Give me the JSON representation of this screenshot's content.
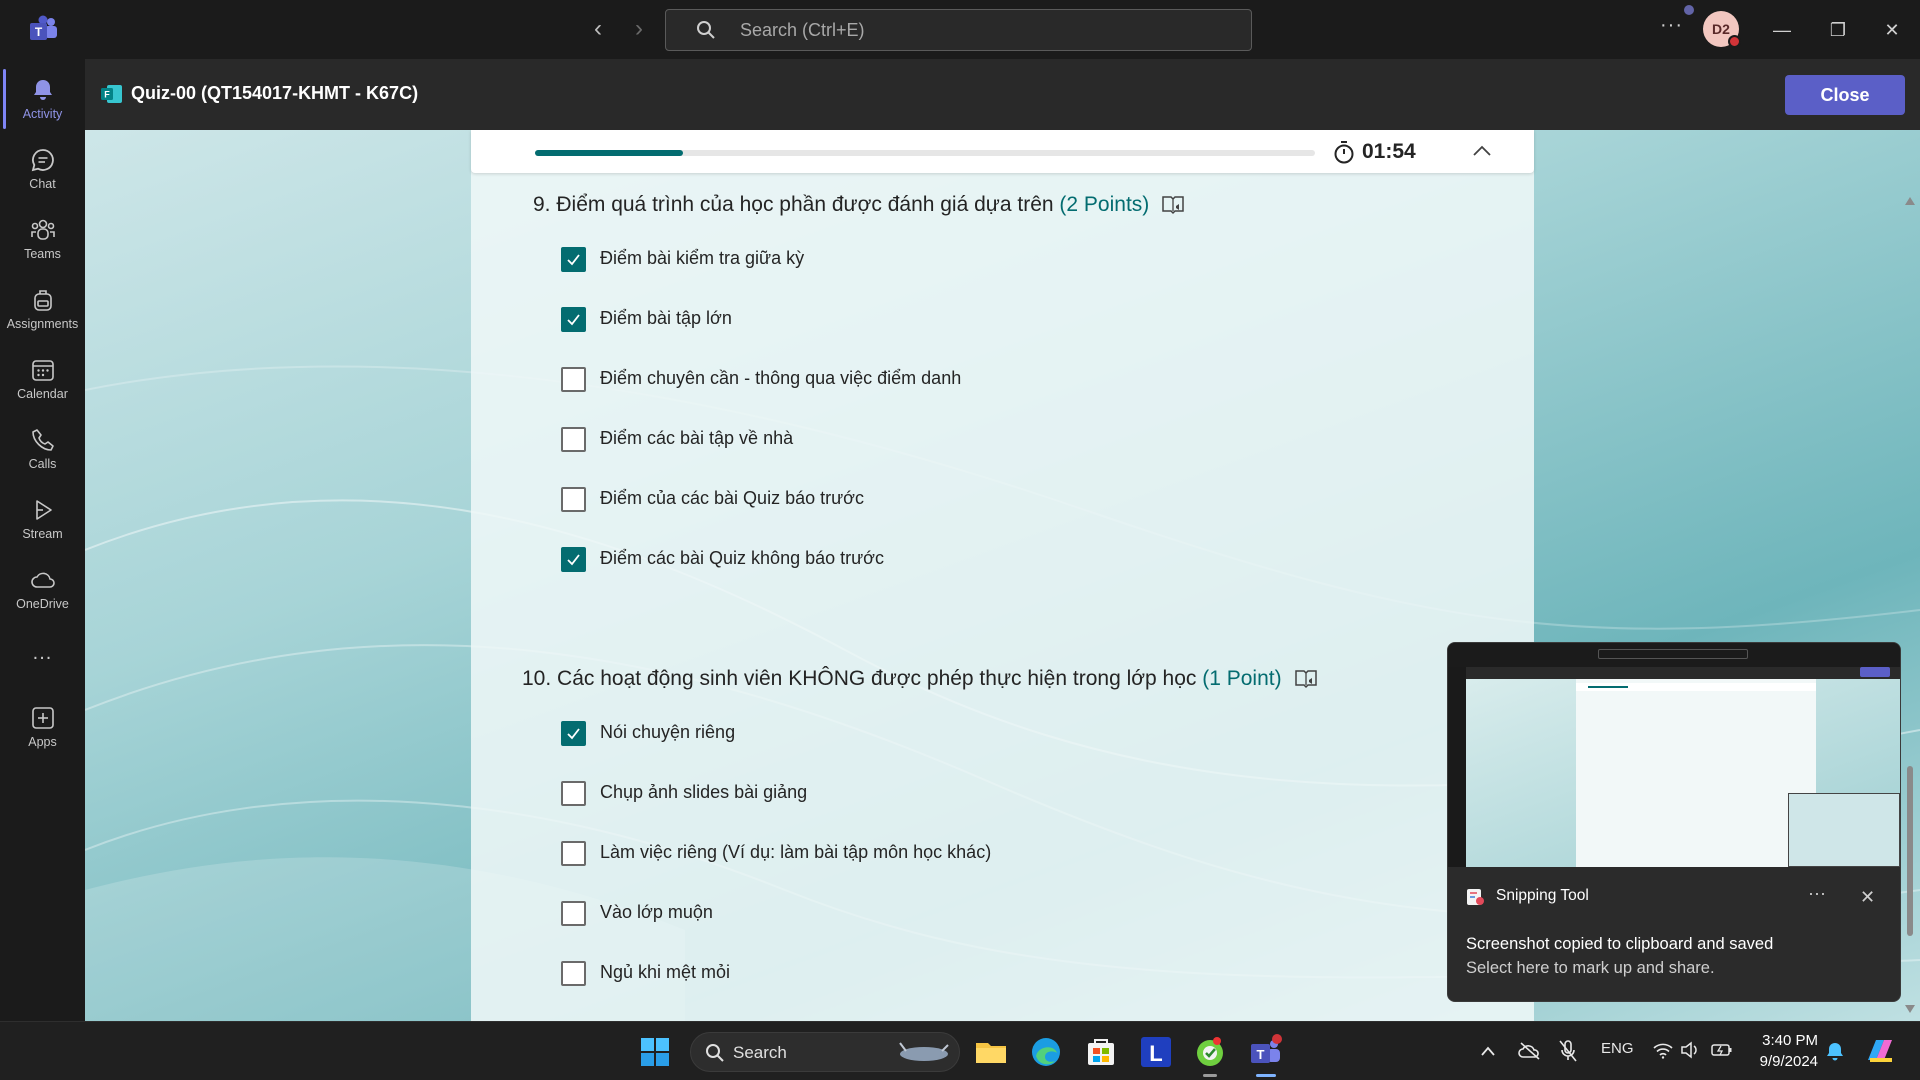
{
  "titlebar": {
    "search_placeholder": "Search (Ctrl+E)",
    "avatar_initials": "D2"
  },
  "rail": {
    "items": [
      {
        "label": "Activity",
        "active": true
      },
      {
        "label": "Chat"
      },
      {
        "label": "Teams"
      },
      {
        "label": "Assignments"
      },
      {
        "label": "Calendar"
      },
      {
        "label": "Calls"
      },
      {
        "label": "Stream"
      },
      {
        "label": "OneDrive"
      },
      {
        "label": "..."
      },
      {
        "label": "Apps"
      }
    ]
  },
  "header": {
    "title": "Quiz-00 (QT154017-KHMT - K67C)",
    "close_label": "Close"
  },
  "quiz": {
    "progress_fraction": 0.19,
    "timer": "01:54",
    "questions": [
      {
        "number": "9.",
        "text": "Điểm quá trình của học phần được đánh giá dựa trên",
        "points": "(2 Points)",
        "options": [
          {
            "label": "Điểm bài kiểm tra giữa kỳ",
            "checked": true
          },
          {
            "label": "Điểm bài tập lớn",
            "checked": true
          },
          {
            "label": "Điểm chuyên cần - thông qua việc điểm danh",
            "checked": false
          },
          {
            "label": "Điểm các bài tập về nhà",
            "checked": false
          },
          {
            "label": "Điểm của các bài Quiz báo trước",
            "checked": false
          },
          {
            "label": "Điểm các bài Quiz không báo trước",
            "checked": true
          }
        ]
      },
      {
        "number": "10.",
        "text": "Các hoạt động sinh viên KHÔNG được phép thực hiện trong lớp học",
        "points": "(1 Point)",
        "options": [
          {
            "label": "Nói chuyện riêng",
            "checked": true
          },
          {
            "label": "Chụp ảnh slides bài giảng",
            "checked": false
          },
          {
            "label": "Làm việc riêng (Ví dụ: làm bài tập môn học khác)",
            "checked": false
          },
          {
            "label": "Vào lớp muộn",
            "checked": false
          },
          {
            "label": "Ngủ khi mệt mỏi",
            "checked": false
          }
        ]
      }
    ]
  },
  "toast": {
    "app_name": "Snipping Tool",
    "title": "Screenshot copied to clipboard and saved",
    "body": "Select here to mark up and share."
  },
  "taskbar": {
    "search_label": "Search",
    "language": "ENG",
    "time": "3:40 PM",
    "date": "9/9/2024"
  },
  "colors": {
    "accent": "#5b5fc7",
    "forms_teal": "#036c70"
  }
}
